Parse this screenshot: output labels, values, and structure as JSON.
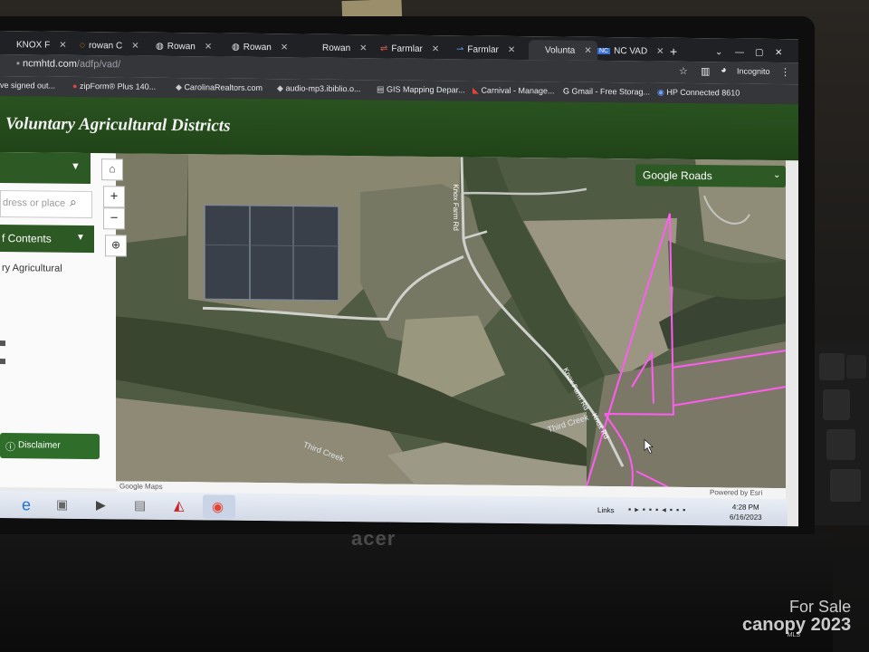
{
  "browser": {
    "tabs": [
      {
        "label": "KNOX F"
      },
      {
        "label": "rowan C"
      },
      {
        "label": "Rowan"
      },
      {
        "label": "Rowan"
      },
      {
        "label": "Rowan"
      },
      {
        "label": "Farmlar"
      },
      {
        "label": "Farmlar"
      },
      {
        "label": "Volunta"
      },
      {
        "label": "NC VAD"
      }
    ],
    "new_tab_label": "+",
    "url_host": "ncmhtd.com",
    "url_path": "/adfp/vad/",
    "incognito_label": "Incognito",
    "bookmarks": [
      "ve signed out...",
      "zipForm® Plus 140...",
      "CarolinaRealtors.com",
      "audio-mp3.ibiblio.o...",
      "GIS Mapping Depar...",
      "Carnival - Manage...",
      "Gmail - Free Storag...",
      "HP Connected 8610"
    ]
  },
  "app": {
    "title": "Voluntary Agricultural Districts",
    "search_placeholder": "dress or place",
    "toc_label": "f Contents",
    "toc_item": "ry Agricultural",
    "disclaimer_label": "Disclaimer",
    "basemap_label": "Google Roads",
    "map_labels": {
      "road1": "Knox Farm Rd",
      "road2": "Knox Farm Rd",
      "road3": "Knox Rd",
      "creek1": "Third Creek",
      "creek2": "Third Creek"
    },
    "attribution_left": "Google Maps",
    "attribution_right": "Powered by Esri"
  },
  "taskbar": {
    "links_label": "Links",
    "time": "4:28 PM",
    "date": "6/16/2023"
  },
  "device": {
    "brand": "acer"
  },
  "watermark": {
    "line1": "For Sale",
    "line2": "canopy 2023",
    "line3": "MLS"
  },
  "colors": {
    "header_green": "#204418",
    "button_green": "#2d5a24",
    "parcel_outline": "#ff5cf0"
  }
}
